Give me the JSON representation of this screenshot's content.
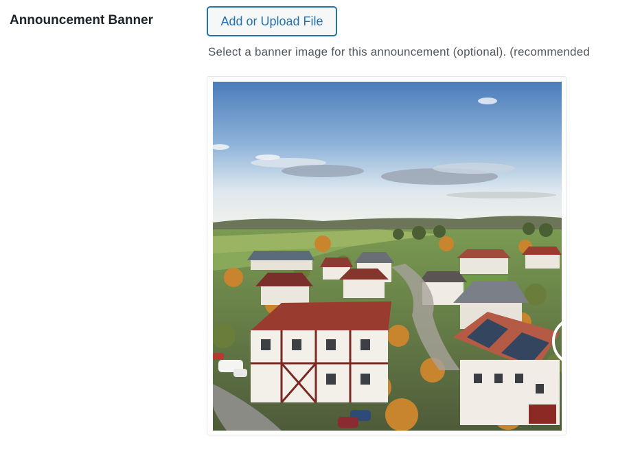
{
  "field": {
    "label": "Announcement Banner",
    "button_label": "Add or Upload File",
    "description": "Select a banner image for this announcement (optional). (recommended"
  },
  "preview": {
    "subject": "aerial view of a village with red-roofed houses, autumn trees, fields and blue sky"
  },
  "colors": {
    "accent": "#2271b1",
    "label_text": "#1d2327",
    "description_text": "#50575e",
    "sky_top": "#4d7fbd",
    "roof_red": "#9a3b2f"
  }
}
